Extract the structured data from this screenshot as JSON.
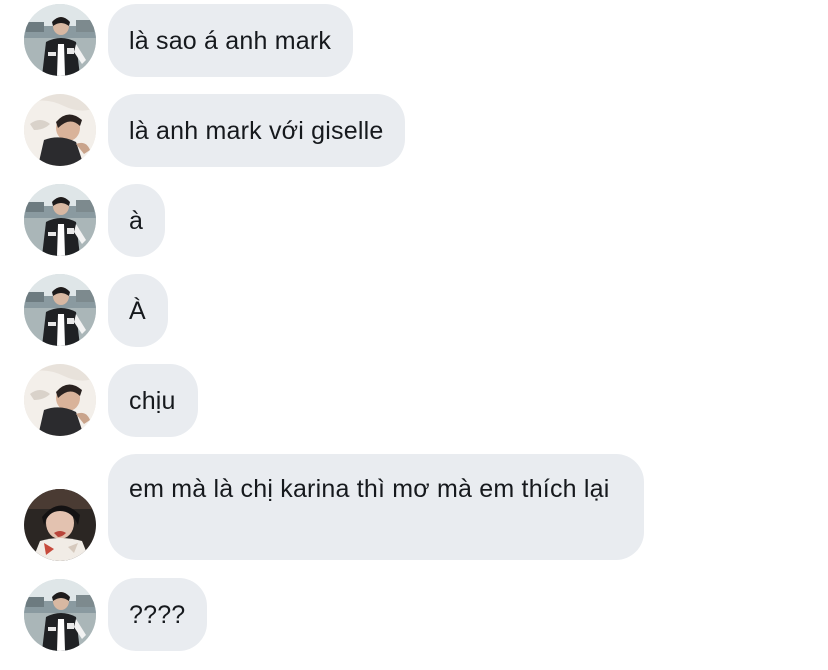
{
  "messages": [
    {
      "avatar": "avatar-a",
      "text": "là sao á anh mark"
    },
    {
      "avatar": "avatar-b",
      "text": "là anh mark với giselle"
    },
    {
      "avatar": "avatar-a",
      "text": "à"
    },
    {
      "avatar": "avatar-a",
      "text": "À"
    },
    {
      "avatar": "avatar-b",
      "text": "chịu"
    },
    {
      "avatar": "avatar-c",
      "text": "em mà là chị karina thì mơ mà em thích lại"
    },
    {
      "avatar": "avatar-a",
      "text": "????"
    }
  ],
  "colors": {
    "bubble": "#e9ecf0",
    "text": "#16191d",
    "background": "#ffffff"
  }
}
